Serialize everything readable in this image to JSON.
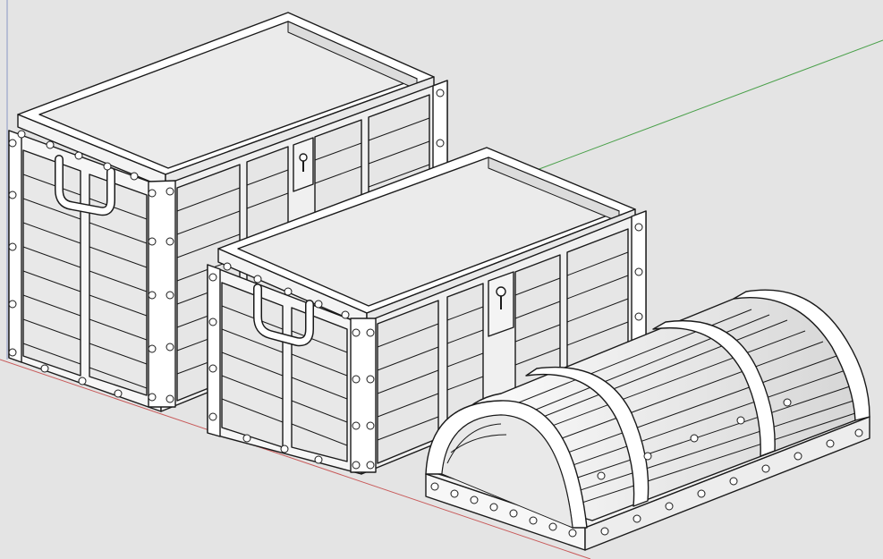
{
  "viewport": {
    "background": "#e4e4e4",
    "axis_colors": {
      "red": "#c85a5a",
      "green": "#4aa04a",
      "blue": "#6d7bb0"
    }
  },
  "objects": [
    {
      "name": "treasure-chest-large",
      "type": "open box"
    },
    {
      "name": "treasure-chest-medium",
      "type": "open box"
    },
    {
      "name": "chest-lid-arched",
      "type": "arched lid"
    }
  ]
}
